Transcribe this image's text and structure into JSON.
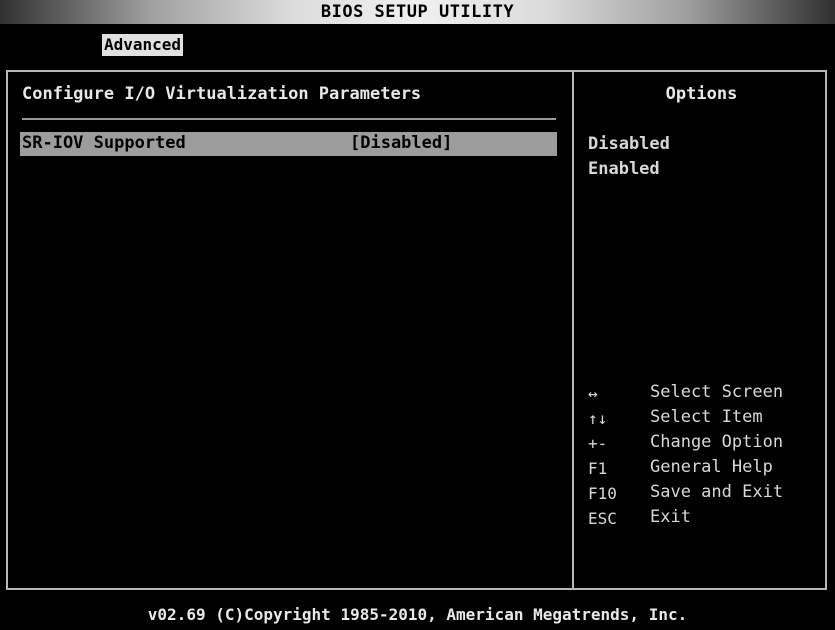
{
  "header": {
    "title": "BIOS SETUP UTILITY",
    "active_tab": "Advanced"
  },
  "main": {
    "section_title": "Configure I/O Virtualization Parameters",
    "settings": [
      {
        "label": "SR-IOV Supported",
        "value": "[Disabled]"
      }
    ]
  },
  "options_panel": {
    "title": "Options",
    "items": [
      "Disabled",
      "Enabled"
    ]
  },
  "help": [
    {
      "key": "↔",
      "desc": "Select Screen",
      "key_icon": "left-right-arrow-icon"
    },
    {
      "key": "↑↓",
      "desc": "Select Item",
      "key_icon": "up-down-arrow-icon"
    },
    {
      "key": "+-",
      "desc": "Change Option"
    },
    {
      "key": "F1",
      "desc": "General Help"
    },
    {
      "key": "F10",
      "desc": "Save and Exit"
    },
    {
      "key": "ESC",
      "desc": "Exit"
    }
  ],
  "footer": {
    "copyright": "v02.69 (C)Copyright 1985-2010, American Megatrends, Inc."
  },
  "colors": {
    "background": "#000000",
    "highlight": "#9c9c9c",
    "text": "#d8d8d8",
    "border": "#b8b8b8"
  }
}
